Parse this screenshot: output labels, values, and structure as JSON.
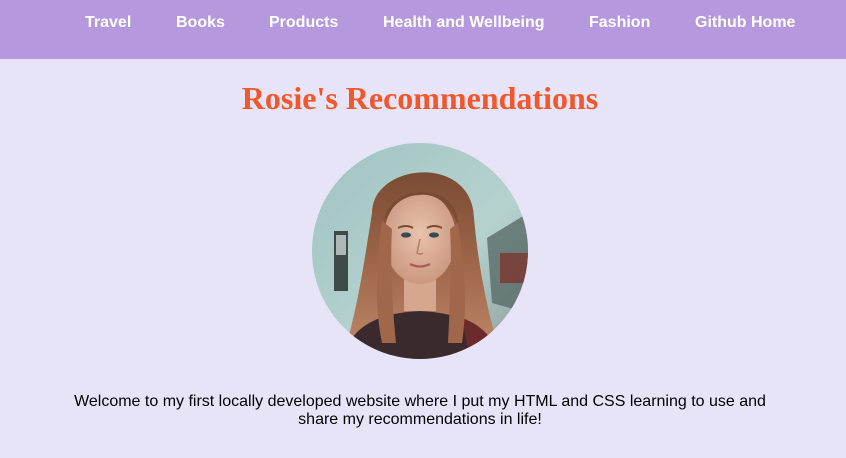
{
  "nav": {
    "items": [
      {
        "label": "Travel"
      },
      {
        "label": "Books"
      },
      {
        "label": "Products"
      },
      {
        "label": "Health and Wellbeing"
      },
      {
        "label": "Fashion"
      },
      {
        "label": "Github Home"
      }
    ]
  },
  "header": {
    "title": "Rosie's Recommendations"
  },
  "main": {
    "intro": "Welcome to my first locally developed website where I put my HTML and CSS learning to use and share my recommendations in life!"
  },
  "colors": {
    "nav_background": "#b698df",
    "page_background": "#e8e4f8",
    "title_accent": "#f0582c",
    "nav_text": "#ffffff"
  }
}
